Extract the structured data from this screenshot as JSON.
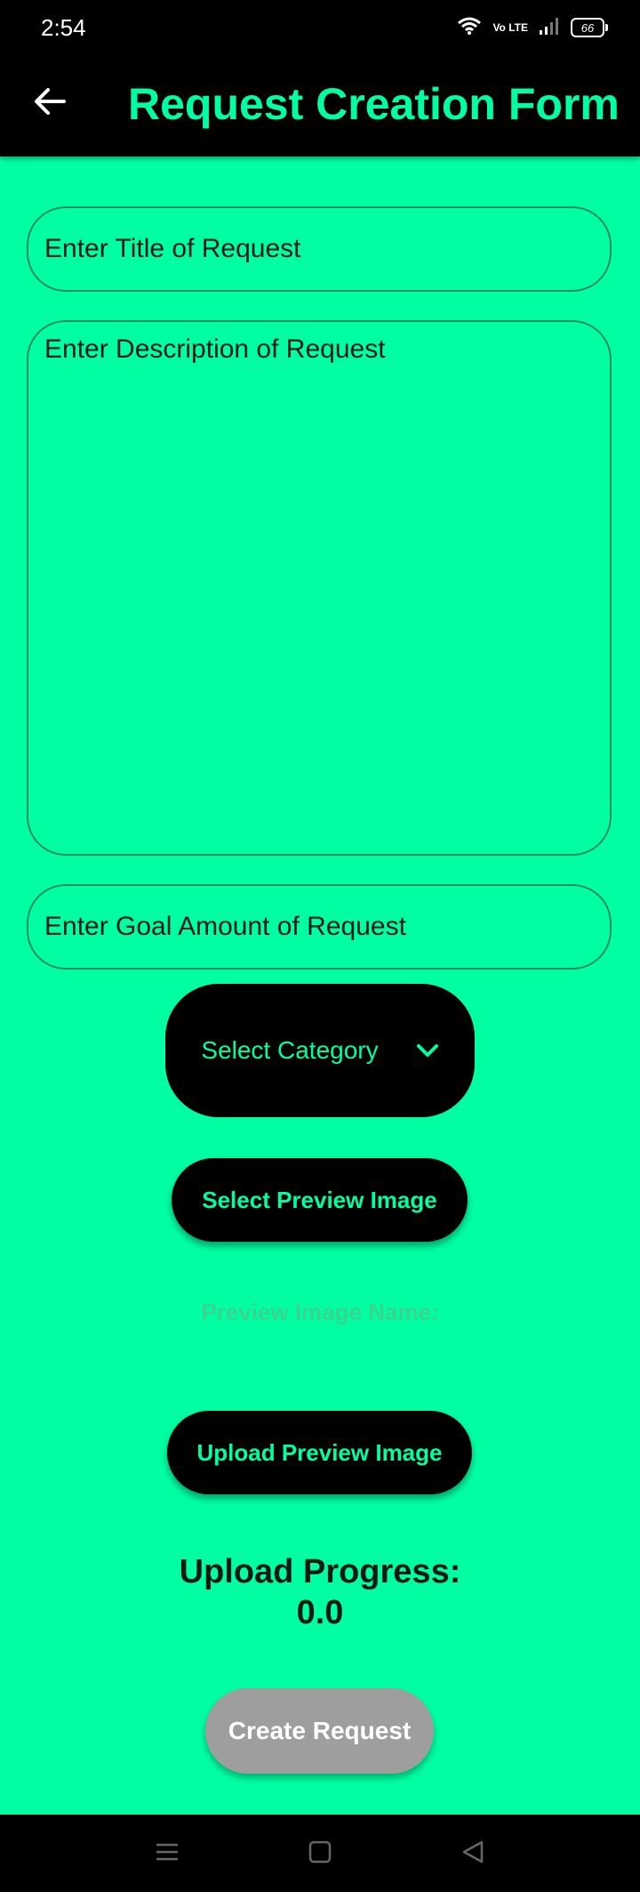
{
  "status_bar": {
    "time": "2:54",
    "network_label": "Vo LTE",
    "battery_level": "66",
    "icons": [
      "wifi-icon",
      "volte-icon",
      "signal-icon",
      "battery-icon"
    ]
  },
  "app_bar": {
    "title": "Request Creation Form",
    "back_icon": "arrow-back-icon"
  },
  "form": {
    "title_placeholder": "Enter Title of Request",
    "description_placeholder": "Enter Description of Request",
    "goal_placeholder": "Enter Goal Amount of Request",
    "category_label": "Select Category",
    "category_icon": "chevron-down-icon",
    "select_image_label": "Select Preview Image",
    "preview_image_name_label": "Preview Image Name:",
    "upload_image_label": "Upload Preview Image",
    "upload_progress_label": "Upload Progress:",
    "upload_progress_value": "0.0",
    "create_label": "Create Request"
  },
  "colors": {
    "background": "#00FFA3",
    "accent": "#00FFA3",
    "app_bar": "#000000",
    "disabled_button": "#9E9E9E"
  },
  "nav_bar": {
    "icons": [
      "menu-icon",
      "home-square-icon",
      "back-triangle-icon"
    ]
  }
}
